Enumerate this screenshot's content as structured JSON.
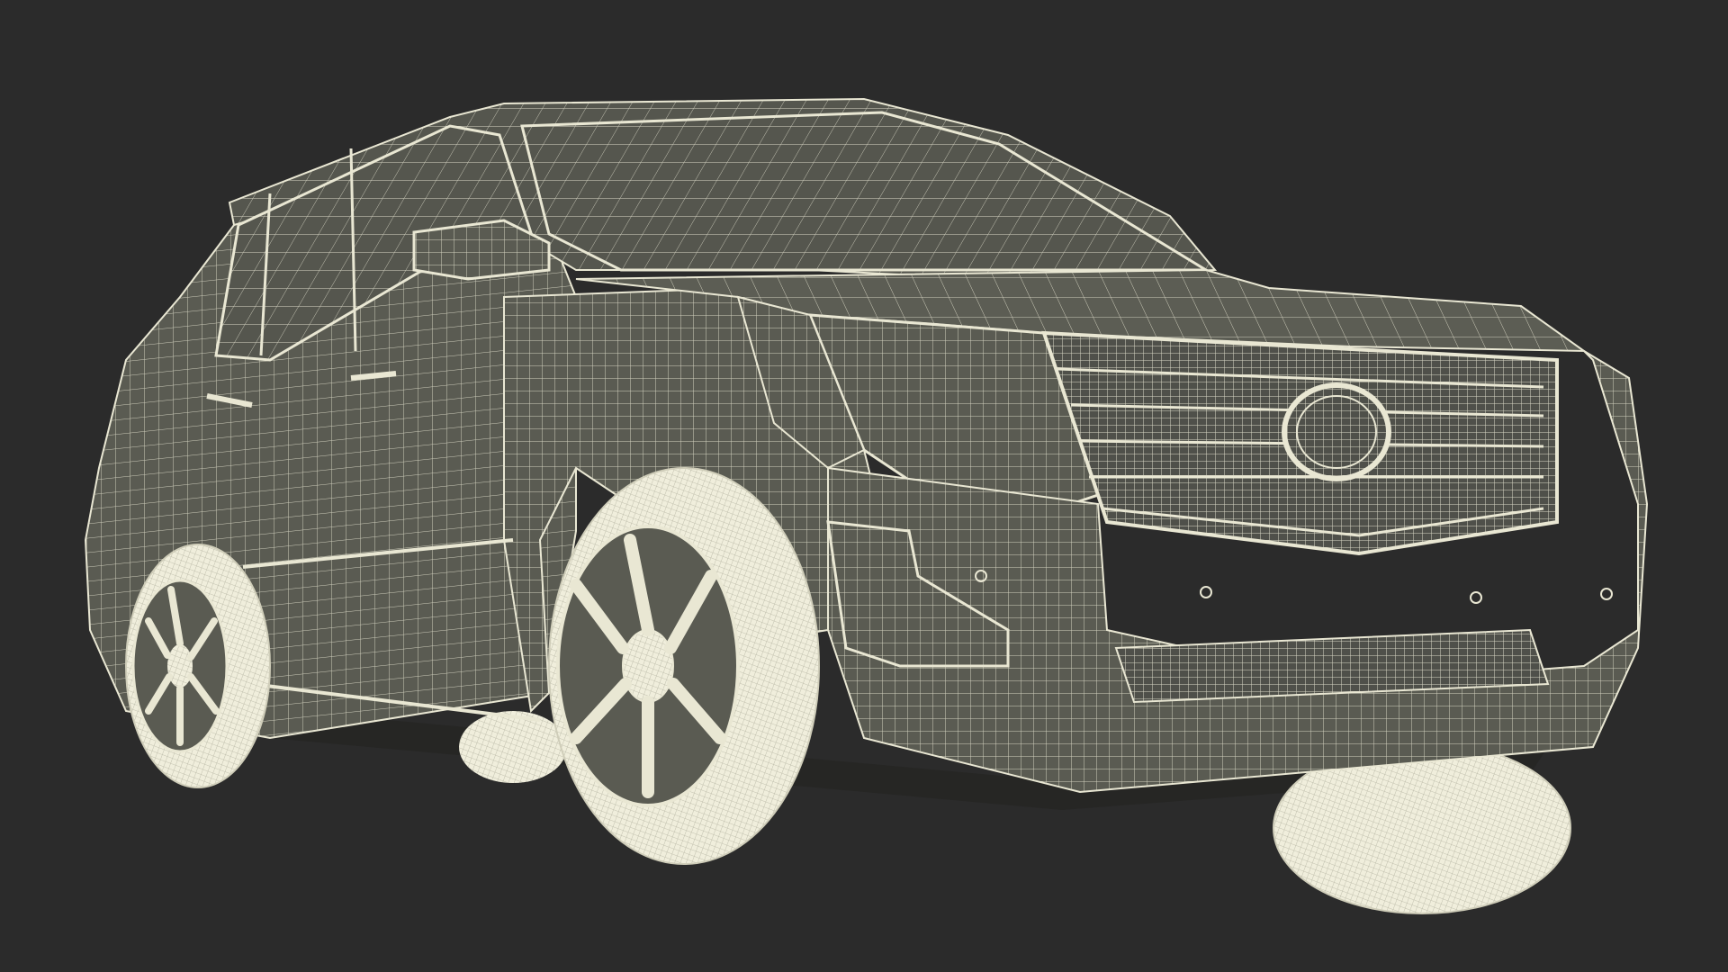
{
  "scene": {
    "subject": "wireframe-suv-render",
    "background_color": "#2b2b2b",
    "surface_color": "#5a5b52",
    "wire_color": "#e9e7d3",
    "wheel_color": "#f0eedc",
    "dark_gap_color": "#262624"
  }
}
